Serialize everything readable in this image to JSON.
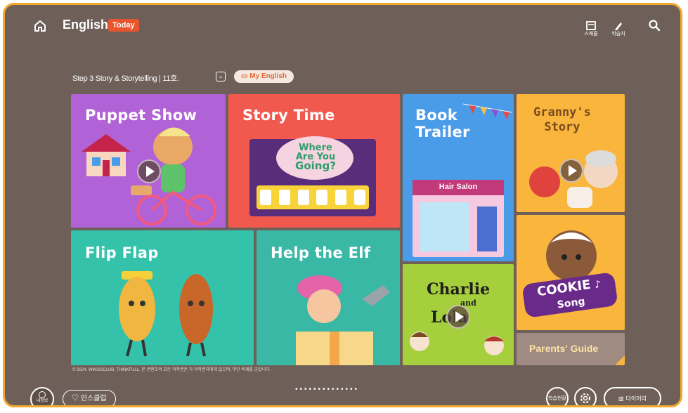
{
  "header": {
    "title": "English",
    "badge": "Today",
    "icons": [
      {
        "name": "schedule-icon",
        "label": "스케줄"
      },
      {
        "name": "pencil-icon",
        "label": "학습지"
      },
      {
        "name": "search-icon",
        "label": ""
      }
    ]
  },
  "course": {
    "step_label": "Step 3 Story & Storytelling | 11호.",
    "my_english": "My English"
  },
  "tiles": {
    "puppet_show": "Puppet Show",
    "story_time": "Story Time",
    "story_time_sign": [
      "Where",
      "Are You",
      "Going?"
    ],
    "book_trailer": [
      "Book",
      "Trailer"
    ],
    "book_trailer_sign": "Hair Salon",
    "grannys_story": [
      "Granny's",
      "Story"
    ],
    "flip_flap": "Flip Flap",
    "help_the_elf": "Help the Elf",
    "charlie_lola": [
      "Charlie",
      "and",
      "Lola"
    ],
    "cookie_song": [
      "COOKIE",
      "Song"
    ],
    "parents_guide": "Parents' Guide"
  },
  "footer": {
    "copyright": "© 2024. WINGSCLUB, THINKFULL. 본 콘텐츠의 모든 저작권은 각 저작권자에게 있으며, 무단 복제를 금합니다.",
    "pagination": "••••••••••••••",
    "left_button": "내정보",
    "pill_button": "인스클럽",
    "right_buttons": [
      "학습현황",
      "설정",
      "다이어리"
    ]
  },
  "colors": {
    "frame_border": "#f2a92a",
    "background": "#6e6059",
    "puppet_show": "#b062d6",
    "story_time": "#f1594f",
    "book_trailer": "#4a9be8",
    "grannys_story": "#f9b53c",
    "flip_flap": "#35c2aa",
    "help_the_elf": "#39b8a6",
    "charlie_lola": "#a5cf3c",
    "cookie_song": "#f9b53c",
    "parents_guide": "#a08b82"
  }
}
